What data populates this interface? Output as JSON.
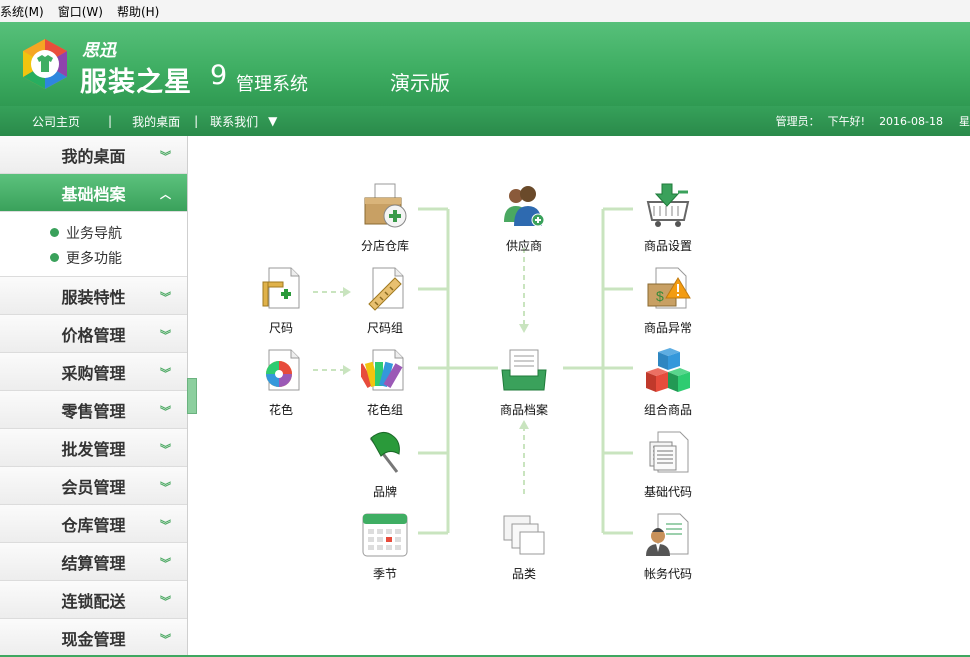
{
  "menu": [
    "系统(M)",
    "窗口(W)",
    "帮助(H)"
  ],
  "banner": {
    "brand_small": "思迅",
    "brand_name": "服装之星",
    "version": "9",
    "subtitle": "管理系统",
    "edition": "演示版"
  },
  "nav": {
    "home": "公司主页",
    "desk": "我的桌面",
    "contact": "联系我们",
    "admin": "管理员：",
    "greeting": "下午好!",
    "date": "2016-08-18",
    "weekday": "星"
  },
  "sidebar": {
    "items": [
      "我的桌面",
      "基础档案",
      "服装特性",
      "价格管理",
      "采购管理",
      "零售管理",
      "批发管理",
      "会员管理",
      "仓库管理",
      "结算管理",
      "连锁配送",
      "现金管理"
    ],
    "active": "基础档案",
    "sub": [
      "业务导航",
      "更多功能"
    ]
  },
  "nodes": {
    "warehouse": "分店仓库",
    "supplier": "供应商",
    "product_settings": "商品设置",
    "size": "尺码",
    "size_group": "尺码组",
    "product_exception": "商品异常",
    "color": "花色",
    "color_group": "花色组",
    "product_archive": "商品档案",
    "combo_product": "组合商品",
    "brand": "品牌",
    "base_code": "基础代码",
    "season": "季节",
    "category": "品类",
    "finance_code": "帐务代码"
  },
  "colors": {
    "accent": "#3fae63",
    "line": "#c9e4bf"
  }
}
